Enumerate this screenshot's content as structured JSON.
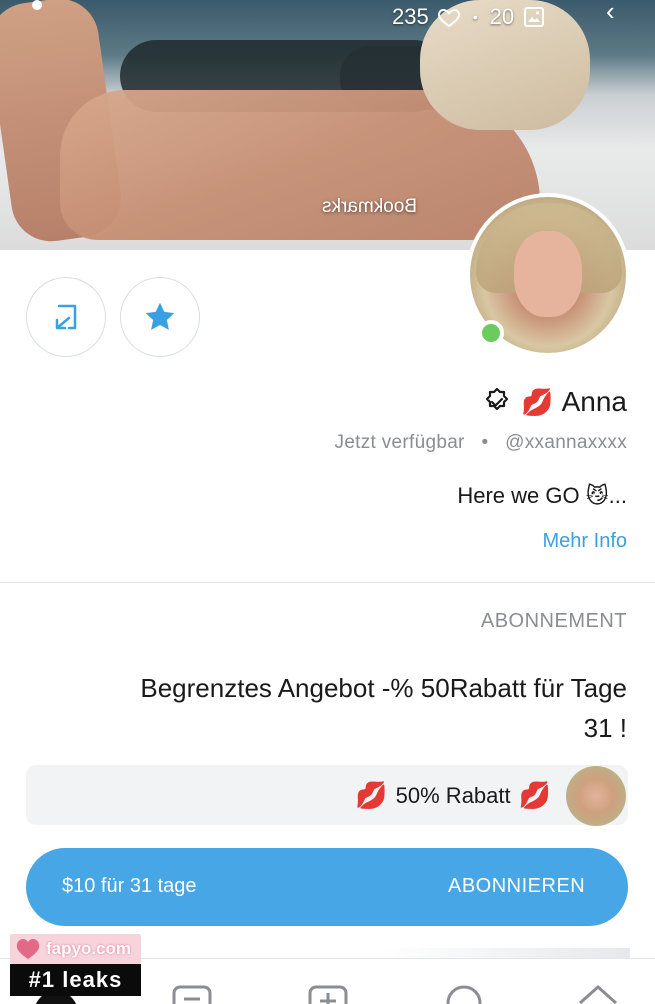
{
  "header": {
    "likes_count": "235",
    "media_count": "20",
    "separator": "•",
    "bookmarks_label": "Bookmarks"
  },
  "profile": {
    "name": "Anna",
    "name_emoji": "💋",
    "handle": "@xxannaxxxx",
    "handle_separator": "•",
    "status": "Jetzt verfügbar",
    "bio": "Here we GO 😼...",
    "more_info": "Mehr Info"
  },
  "subscription": {
    "section_title": "ABONNEMENT",
    "promo_line1": "Begrenztes Angebot -% 50Rabatt für Tage",
    "promo_line2": "31 !",
    "discount_emoji_left": "💋",
    "discount_text": "50% Rabatt",
    "discount_emoji_right": "💋",
    "button_label": "ABONNIEREN",
    "button_price": "$10 für 31 tage"
  },
  "watermark": {
    "site": "fapyo.com",
    "tagline": "#1 leaks"
  },
  "colors": {
    "accent": "#47a6e6",
    "link": "#3aa0e4",
    "online": "#6ccb5f",
    "muted": "#8a8d91"
  }
}
